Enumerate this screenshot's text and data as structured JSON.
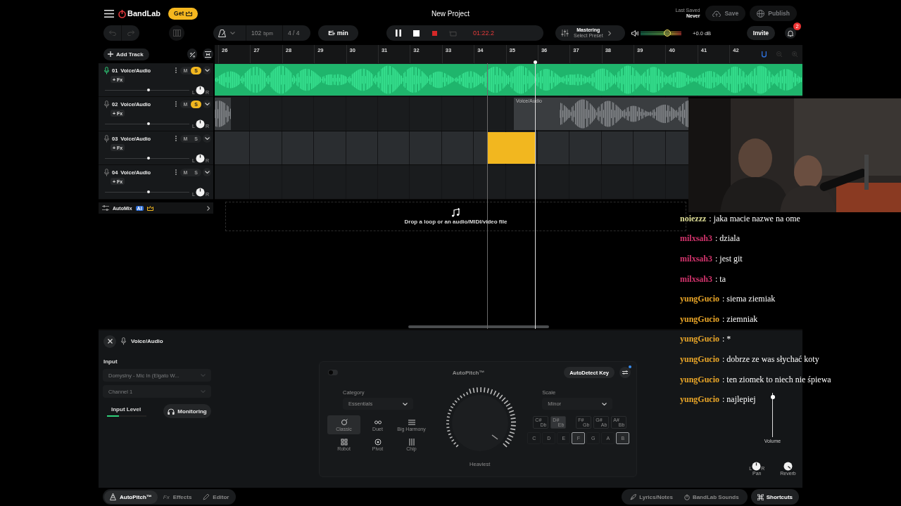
{
  "app": {
    "logo": "BandLab",
    "get_button": "Get",
    "title": "New Project",
    "last_saved_label": "Last Saved",
    "last_saved_value": "Never",
    "save_button": {
      "label": "Save",
      "disabled": true
    },
    "publish_button": {
      "label": "Publish",
      "disabled": true
    }
  },
  "toolbar": {
    "tempo": {
      "value": "102",
      "unit": "bpm",
      "disabled": true
    },
    "time_signature": {
      "value": "4 / 4",
      "disabled": true
    },
    "key": "E♭ min",
    "transport": {
      "playing": true,
      "loop": false,
      "time": "01:22.2"
    },
    "mastering": {
      "title": "Mastering",
      "preset": "Select Preset"
    },
    "master_volume": {
      "level": 0.65
    },
    "master_gain": "+0.0 dB",
    "invite": "Invite",
    "notifications": "2"
  },
  "add_track": "Add Track",
  "ruler": [
    "26",
    "27",
    "28",
    "29",
    "30",
    "31",
    "32",
    "33",
    "34",
    "35",
    "36",
    "37",
    "38",
    "39",
    "40",
    "41",
    "42"
  ],
  "tracks": [
    {
      "number": "01",
      "name": "Voice/Audio",
      "fx": "+ Fx",
      "mute": "M",
      "solo": "S",
      "armed": true,
      "soloed": true,
      "selected": false,
      "volume": {
        "level": 0.52
      },
      "pan_left": "L",
      "pan_right": "R",
      "clips": [
        {
          "kind": "waveform",
          "color": "#1fb56c"
        }
      ]
    },
    {
      "number": "02",
      "name": "Voice/Audio",
      "fx": "+ Fx",
      "mute": "M",
      "solo": "S",
      "armed": false,
      "soloed": true,
      "selected": false,
      "volume": {
        "level": 0.52
      },
      "pan_left": "L",
      "pan_right": "R",
      "clips": [
        {
          "kind": "waveform",
          "color": "#3a3d40"
        },
        {
          "kind": "waveform",
          "color": "#3a3d40",
          "label": "Voice/Audio"
        }
      ]
    },
    {
      "number": "03",
      "name": "Voice/Audio",
      "fx": "+ Fx",
      "mute": "M",
      "solo": "S",
      "armed": false,
      "soloed": false,
      "selected": true,
      "volume": {
        "level": 0.52
      },
      "pan_left": "L",
      "pan_right": "R",
      "clips": [
        {
          "kind": "region",
          "color": "#f2b71f"
        }
      ]
    },
    {
      "number": "04",
      "name": "Voice/Audio",
      "fx": "+ Fx",
      "mute": "M",
      "solo": "S",
      "armed": false,
      "soloed": false,
      "selected": false,
      "volume": {
        "level": 0.52
      },
      "pan_left": "L",
      "pan_right": "R"
    }
  ],
  "automix": {
    "label": "AutoMix",
    "badge": "AI"
  },
  "drop_hint": "Drop a loop or an audio/MIDI/video file",
  "inspector": {
    "track_name": "Voice/Audio",
    "input_label": "Input",
    "input_device": {
      "value": "Domyslny - Mic In (Elgato W...",
      "disabled": true
    },
    "input_channel": {
      "value": "Channel 1",
      "disabled": true
    },
    "input_level_label": "Input Level",
    "input_level": {
      "level": 0.3
    },
    "monitoring": "Monitoring",
    "autopitch": {
      "enabled": false,
      "title": "AutoPitch™",
      "autodetect": "AutoDetect Key",
      "category_label": "Category",
      "category": "Essentials",
      "presets": [
        {
          "label": "Classic",
          "selected": true
        },
        {
          "label": "Duet",
          "selected": false
        },
        {
          "label": "Big Harmony",
          "selected": false
        },
        {
          "label": "Robot",
          "selected": false
        },
        {
          "label": "Pivot",
          "selected": false
        },
        {
          "label": "Chip",
          "selected": false
        }
      ],
      "knob_label": "Heaviest",
      "scale_label": "Scale",
      "scale": "Minor",
      "sharp_keys": [
        {
          "sharp": "C#",
          "flat": "Db",
          "selected": false
        },
        {
          "sharp": "D#",
          "flat": "Eb",
          "selected": true
        },
        {
          "sharp": "F#",
          "flat": "Gb",
          "selected": false
        },
        {
          "sharp": "G#",
          "flat": "Ab",
          "selected": false
        },
        {
          "sharp": "A#",
          "flat": "Bb",
          "selected": false
        }
      ],
      "keys": [
        {
          "label": "C",
          "selected": false
        },
        {
          "label": "D",
          "selected": false
        },
        {
          "label": "E",
          "selected": false
        },
        {
          "label": "F",
          "selected": true
        },
        {
          "label": "G",
          "selected": false
        },
        {
          "label": "A",
          "selected": false
        },
        {
          "label": "B",
          "selected": true
        }
      ]
    },
    "volume_label": "Volume",
    "volume": {
      "level": 0.9
    },
    "pan_label": "Pan",
    "pan_left": "L",
    "pan_right": "R",
    "reverb_label": "Reverb"
  },
  "bottom_tabs": [
    {
      "label": "AutoPitch™",
      "selected": true
    },
    {
      "label": "Effects",
      "glyph": "Fx",
      "selected": false
    },
    {
      "label": "Editor",
      "selected": false
    }
  ],
  "footer_buttons": [
    {
      "kind": "lyrics",
      "label": "Lyrics/Notes"
    },
    {
      "kind": "sounds",
      "label": "BandLab Sounds"
    },
    {
      "kind": "shortcuts",
      "label": "Shortcuts"
    }
  ],
  "chat": [
    {
      "user": "noiezzz",
      "color": "#dcdc96",
      "message": ": jaka macie nazwe na ome"
    },
    {
      "user": "milxsah3",
      "color": "#d2346c",
      "message": ": dziala"
    },
    {
      "user": "milxsah3",
      "color": "#d2346c",
      "message": ": jest git"
    },
    {
      "user": "milxsah3",
      "color": "#d2346c",
      "message": ": ta"
    },
    {
      "user": "yungGucio",
      "color": "#eaa628",
      "message": ": siema ziemiak"
    },
    {
      "user": "yungGucio",
      "color": "#eaa628",
      "message": ": ziemniak"
    },
    {
      "user": "yungGucio",
      "color": "#eaa628",
      "message": ": *"
    },
    {
      "user": "yungGucio",
      "color": "#eaa628",
      "message": ": dobrze ze was słychać koty"
    },
    {
      "user": "yungGucio",
      "color": "#eaa628",
      "message": ": ten ziomek to niech nie śpiewa"
    },
    {
      "user": "yungGucio",
      "color": "#eaa628",
      "message": ": najlepiej"
    }
  ]
}
